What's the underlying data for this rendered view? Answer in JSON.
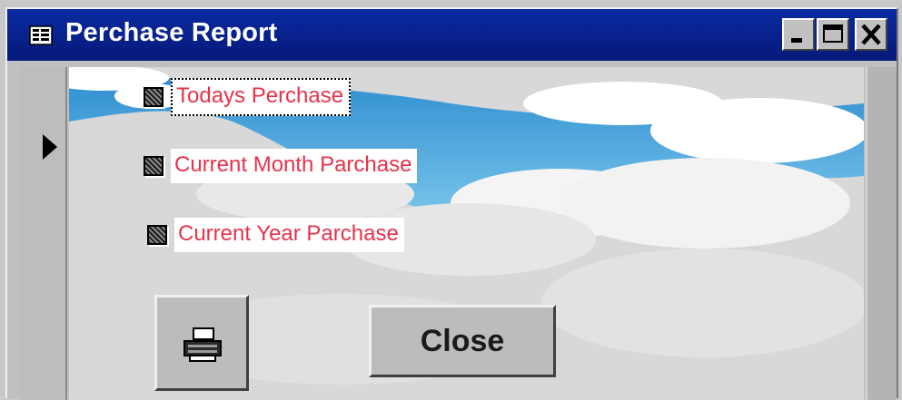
{
  "window": {
    "title": "Perchase Report",
    "title_icon": "form-icon",
    "controls": [
      "minimize-icon",
      "maximize-icon",
      "close-icon"
    ]
  },
  "options": {
    "today_label": "Todays Perchase",
    "month_label": "Current Month Parchase",
    "year_label": "Current Year Parchase"
  },
  "buttons": {
    "print_icon": "printer-icon",
    "close_label": "Close"
  },
  "colors": {
    "title_bar": "#0a2aa0",
    "option_text": "#e8324a",
    "sky": "#4aa6d8"
  }
}
